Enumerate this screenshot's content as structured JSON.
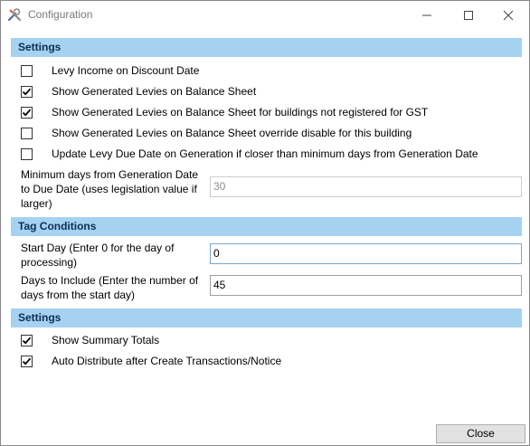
{
  "window": {
    "title": "Configuration",
    "app_icon": "tools-icon"
  },
  "sections": {
    "settings1": "Settings",
    "tag_conditions": "Tag Conditions",
    "settings2": "Settings"
  },
  "settings1": {
    "items": [
      {
        "label": "Levy Income on Discount Date",
        "checked": false
      },
      {
        "label": "Show Generated Levies on Balance Sheet",
        "checked": true
      },
      {
        "label": "Show Generated Levies on Balance Sheet for buildings not registered for GST",
        "checked": true
      },
      {
        "label": "Show Generated Levies on Balance Sheet override disable for this building",
        "checked": false
      },
      {
        "label": "Update Levy Due Date on Generation if closer than minimum days from Generation Date",
        "checked": false
      }
    ],
    "min_days_label": "Minimum days from Generation Date to Due Date (uses legislation value if larger)",
    "min_days_value": "30"
  },
  "tag_conditions": {
    "start_day_label": "Start Day (Enter 0 for the day of processing)",
    "start_day_value": "0",
    "days_include_label": "Days to Include (Enter the number of days from the start day)",
    "days_include_value": "45"
  },
  "settings2": {
    "items": [
      {
        "label": "Show Summary Totals",
        "checked": true
      },
      {
        "label": "Auto Distribute after Create Transactions/Notice",
        "checked": true
      }
    ]
  },
  "footer": {
    "close_label": "Close"
  }
}
